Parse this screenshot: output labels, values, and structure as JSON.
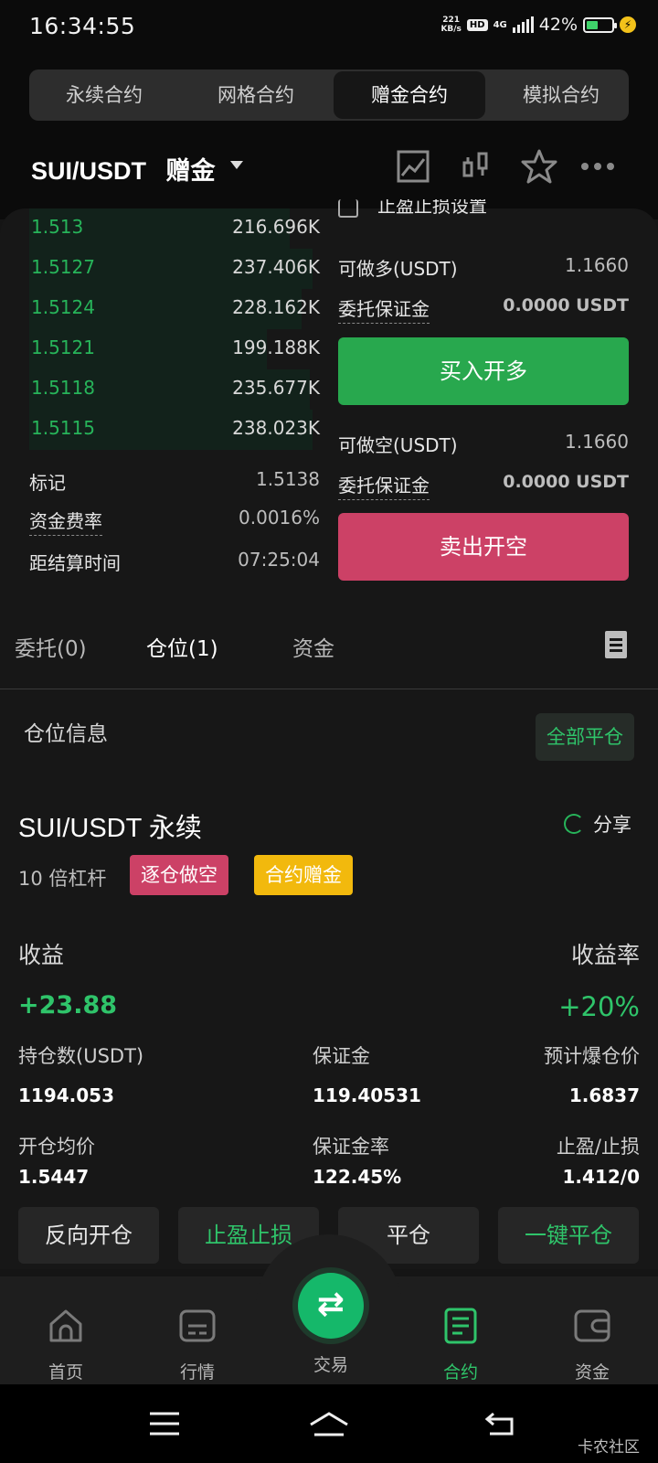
{
  "status": {
    "time": "16:34:55",
    "net_speed_top": "221",
    "net_speed_bottom": "KB/s",
    "hd": "HD",
    "network": "4G",
    "battery": "42%"
  },
  "top_tabs": [
    {
      "label": "永续合约",
      "active": false
    },
    {
      "label": "网格合约",
      "active": false
    },
    {
      "label": "赠金合约",
      "active": true
    },
    {
      "label": "模拟合约",
      "active": false
    }
  ],
  "header": {
    "pair": "SUI/USDT",
    "mode": "赠金",
    "icons": [
      "chart-icon",
      "candlestick-icon",
      "star-icon",
      "more-icon"
    ]
  },
  "order_book": [
    {
      "price": "1.513",
      "qty": "216.696K",
      "depth": 0.92
    },
    {
      "price": "1.5127",
      "qty": "237.406K",
      "depth": 1.0
    },
    {
      "price": "1.5124",
      "qty": "228.162K",
      "depth": 0.96
    },
    {
      "price": "1.5121",
      "qty": "199.188K",
      "depth": 0.84
    },
    {
      "price": "1.5118",
      "qty": "235.677K",
      "depth": 0.99
    },
    {
      "price": "1.5115",
      "qty": "238.023K",
      "depth": 1.0
    }
  ],
  "market_info": {
    "mark_label": "标记",
    "mark_value": "1.5138",
    "funding_label": "资金费率",
    "funding_value": "0.0016%",
    "settle_label": "距结算时间",
    "settle_value": "07:25:04"
  },
  "order_form": {
    "tpsl_setting": "止盈止损设置",
    "long_avail_label": "可做多(USDT)",
    "long_avail_value": "1.1660",
    "long_margin_label": "委托保证金",
    "long_margin_value": "0.0000 USDT",
    "buy_label": "买入开多",
    "short_avail_label": "可做空(USDT)",
    "short_avail_value": "1.1660",
    "short_margin_label": "委托保证金",
    "short_margin_value": "0.0000 USDT",
    "sell_label": "卖出开空"
  },
  "section_tabs": [
    {
      "label": "委托(0)",
      "active": false
    },
    {
      "label": "仓位(1)",
      "active": true
    },
    {
      "label": "资金",
      "active": false
    }
  ],
  "position": {
    "section_title": "仓位信息",
    "close_all_label": "全部平仓",
    "pair": "SUI/USDT 永续",
    "share_label": "分享",
    "leverage": "10 倍杠杆",
    "badge_side": "逐仓做空",
    "badge_bonus": "合约赠金",
    "pnl_label": "收益",
    "pnl_value": "+23.88",
    "roe_label": "收益率",
    "roe_value": "+20%",
    "size_label": "持仓数(USDT)",
    "size_value": "1194.053",
    "margin_label": "保证金",
    "margin_value": "119.40531",
    "liq_label": "预计爆仓价",
    "liq_value": "1.6837",
    "entry_label": "开仓均价",
    "entry_value": "1.5447",
    "margin_ratio_label": "保证金率",
    "margin_ratio_value": "122.45%",
    "tpsl_label": "止盈/止损",
    "tpsl_value": "1.412/0",
    "actions": [
      "反向开仓",
      "止盈止损",
      "平仓",
      "一键平仓"
    ]
  },
  "bottom_nav": [
    {
      "label": "首页",
      "icon": "home-icon",
      "active": false
    },
    {
      "label": "行情",
      "icon": "market-icon",
      "active": false
    },
    {
      "label": "交易",
      "icon": "trade-icon",
      "active": false
    },
    {
      "label": "合约",
      "icon": "contract-icon",
      "active": true
    },
    {
      "label": "资金",
      "icon": "wallet-icon",
      "active": false
    }
  ],
  "watermark": "卡农社区",
  "colors": {
    "green": "#2fc46a",
    "red": "#cc4166",
    "yellow": "#f2b90d",
    "background": "#151515"
  }
}
